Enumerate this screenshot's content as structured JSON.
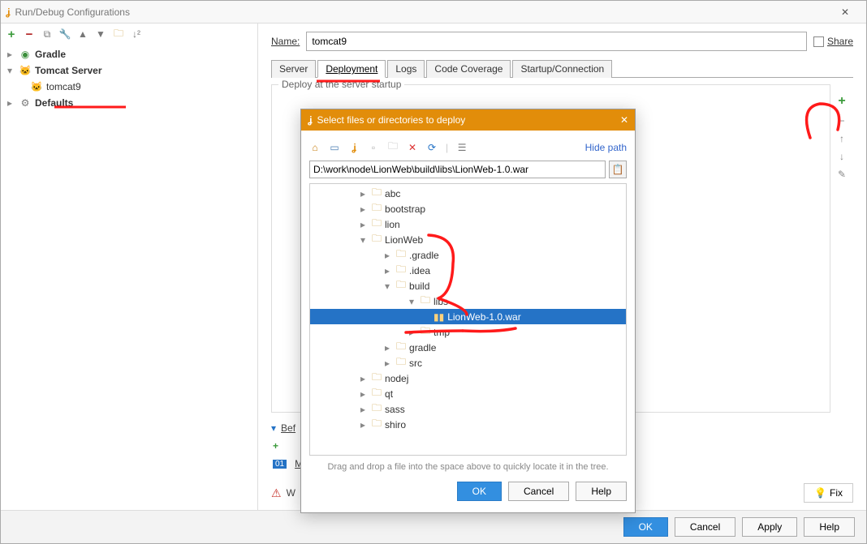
{
  "window": {
    "title": "Run/Debug Configurations"
  },
  "share_label": "Share",
  "left_tree": {
    "gradle": "Gradle",
    "tomcat_server": "Tomcat Server",
    "tomcat9": "tomcat9",
    "defaults": "Defaults"
  },
  "name": {
    "label": "Name:",
    "value": "tomcat9"
  },
  "tabs": {
    "server": "Server",
    "deployment": "Deployment",
    "logs": "Logs",
    "code_coverage": "Code Coverage",
    "startup": "Startup/Connection"
  },
  "deploy_label": "Deploy at the server startup",
  "before_label": "Bef",
  "m_label": "M",
  "w_label": "W",
  "dialog": {
    "title": "Select files or directories to deploy",
    "hide_path": "Hide path",
    "path_value": "D:\\work\\node\\LionWeb\\build\\libs\\LionWeb-1.0.war",
    "nodes": {
      "abc": "abc",
      "bootstrap": "bootstrap",
      "lion": "lion",
      "lionweb": "LionWeb",
      "gradle_hidden": ".gradle",
      "idea": ".idea",
      "build": "build",
      "libs": "libs",
      "war": "LionWeb-1.0.war",
      "tmp": "tmp",
      "gradle": "gradle",
      "src": "src",
      "nodej": "nodej",
      "qt": "qt",
      "sass": "sass",
      "shiro": "shiro"
    },
    "hint": "Drag and drop a file into the space above to quickly locate it in the tree.",
    "ok": "OK",
    "cancel": "Cancel",
    "help": "Help"
  },
  "footer": {
    "fix": "Fix",
    "ok": "OK",
    "cancel": "Cancel",
    "apply": "Apply",
    "help": "Help"
  }
}
